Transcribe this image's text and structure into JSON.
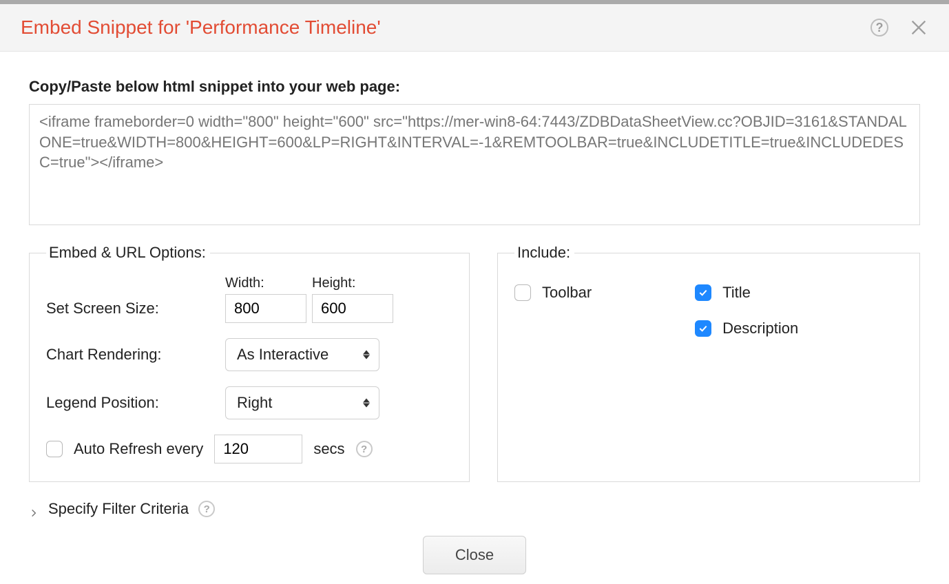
{
  "header": {
    "title": "Embed Snippet for 'Performance Timeline'"
  },
  "instruction": "Copy/Paste below html snippet into your web page:",
  "snippet": "<iframe frameborder=0 width=\"800\" height=\"600\" src=\"https://mer-win8-64:7443/ZDBDataSheetView.cc?OBJID=3161&STANDALONE=true&WIDTH=800&HEIGHT=600&LP=RIGHT&INTERVAL=-1&REMTOOLBAR=true&INCLUDETITLE=true&INCLUDEDESC=true\"></iframe>",
  "embed": {
    "legend": "Embed & URL Options:",
    "screen_size_label": "Set Screen Size:",
    "width_label": "Width:",
    "height_label": "Height:",
    "width_value": "800",
    "height_value": "600",
    "chart_rendering_label": "Chart Rendering:",
    "chart_rendering_value": "As Interactive",
    "legend_position_label": "Legend Position:",
    "legend_position_value": "Right",
    "auto_refresh_label": "Auto Refresh every",
    "auto_refresh_value": "120",
    "auto_refresh_unit": "secs"
  },
  "include": {
    "legend": "Include:",
    "toolbar_label": "Toolbar",
    "title_label": "Title",
    "description_label": "Description"
  },
  "filter_label": "Specify Filter Criteria",
  "footer": {
    "close_label": "Close"
  }
}
